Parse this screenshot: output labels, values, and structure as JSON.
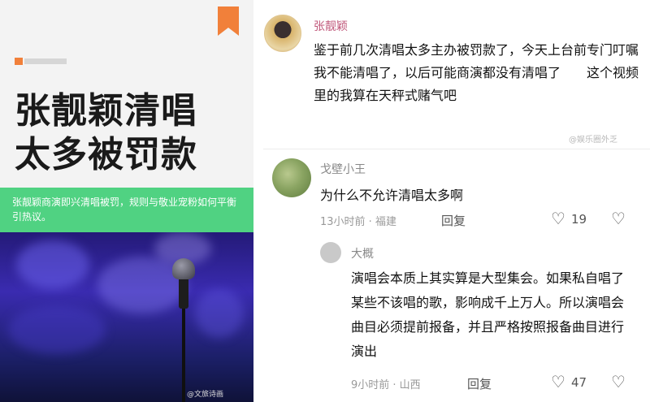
{
  "article": {
    "headline_line1": "张靓颖清唱",
    "headline_line2": "太多被罚款",
    "summary": "张靓颖商演即兴清唱被罚，规则与敬业宠粉如何平衡引热议。",
    "watermark": "@文旅诗画",
    "colors": {
      "accent": "#f1803a",
      "green_banner": "#50d282"
    }
  },
  "post": {
    "author": "张靓颖",
    "text": "鉴于前几次清唱太多主办被罚款了，今天上台前专门叮嘱我不能清唱了，以后可能商演都没有清唱了　　这个视频里的我算在天秤式赌气吧",
    "watermark": "@娱乐圈外乏"
  },
  "comments": [
    {
      "author": "戈壁小王",
      "text": "为什么不允许清唱太多啊",
      "time_location": "13小时前 · 福建",
      "reply_label": "回复",
      "likes": "19"
    },
    {
      "author": "大概",
      "text": "演唱会本质上其实算是大型集会。如果私自唱了某些不该唱的歌，影响成千上万人。所以演唱会曲目必须提前报备，并且严格按照报备曲目进行演出",
      "time_location": "9小时前 · 山西",
      "reply_label": "回复",
      "likes": "47"
    }
  ]
}
